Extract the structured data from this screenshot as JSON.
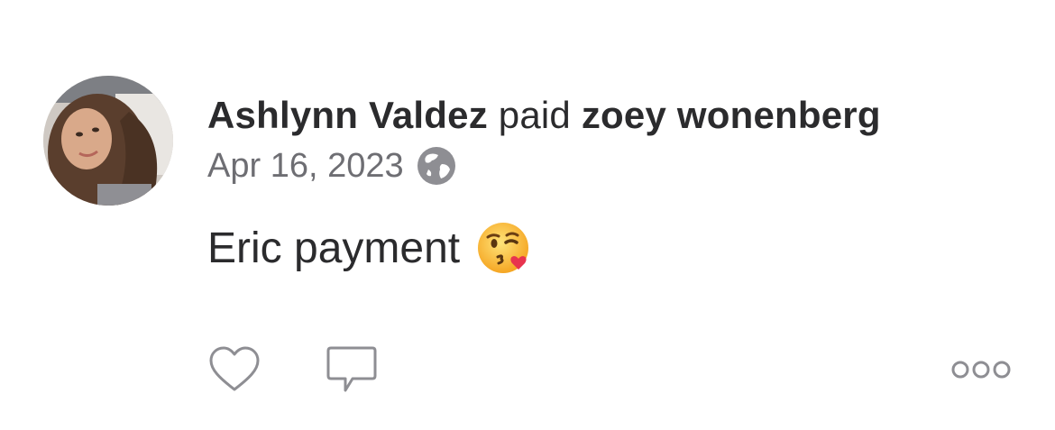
{
  "post": {
    "sender": "Ashlynn Valdez",
    "verb": "paid",
    "recipient": "zoey wonenberg",
    "date": "Apr 16, 2023",
    "privacy_icon": "globe-icon",
    "note": "Eric payment",
    "note_emoji": "kissing-face-emoji"
  },
  "actions": {
    "like_icon": "heart-icon",
    "comment_icon": "comment-icon",
    "more_icon": "more-options-icon"
  },
  "colors": {
    "text_primary": "#2b2b2d",
    "text_secondary": "#6e6e73",
    "icon_gray": "#8e8e93"
  }
}
